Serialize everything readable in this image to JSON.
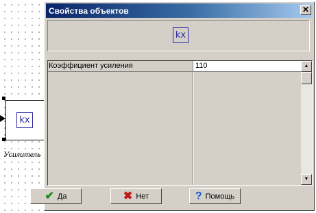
{
  "canvas": {
    "block": {
      "icon_text": "kx",
      "caption": "Усилитель"
    }
  },
  "dialog": {
    "title": "Свойства объектов",
    "close_glyph": "✕",
    "preview_icon_text": "kx",
    "properties": [
      {
        "name": "Коэффициент усиления",
        "value": "110"
      }
    ],
    "scroll_up_glyph": "▲",
    "scroll_down_glyph": "▼",
    "buttons": {
      "ok": {
        "label": "Да",
        "icon": "check-icon"
      },
      "cancel": {
        "label": "Нет",
        "icon": "x-icon"
      },
      "help": {
        "label": "Помощь",
        "icon": "question-icon"
      }
    }
  },
  "colors": {
    "title_start": "#0a246a",
    "title_end": "#a6caf0",
    "face": "#d4d0c8",
    "icon_blue": "#2a2aa0"
  }
}
